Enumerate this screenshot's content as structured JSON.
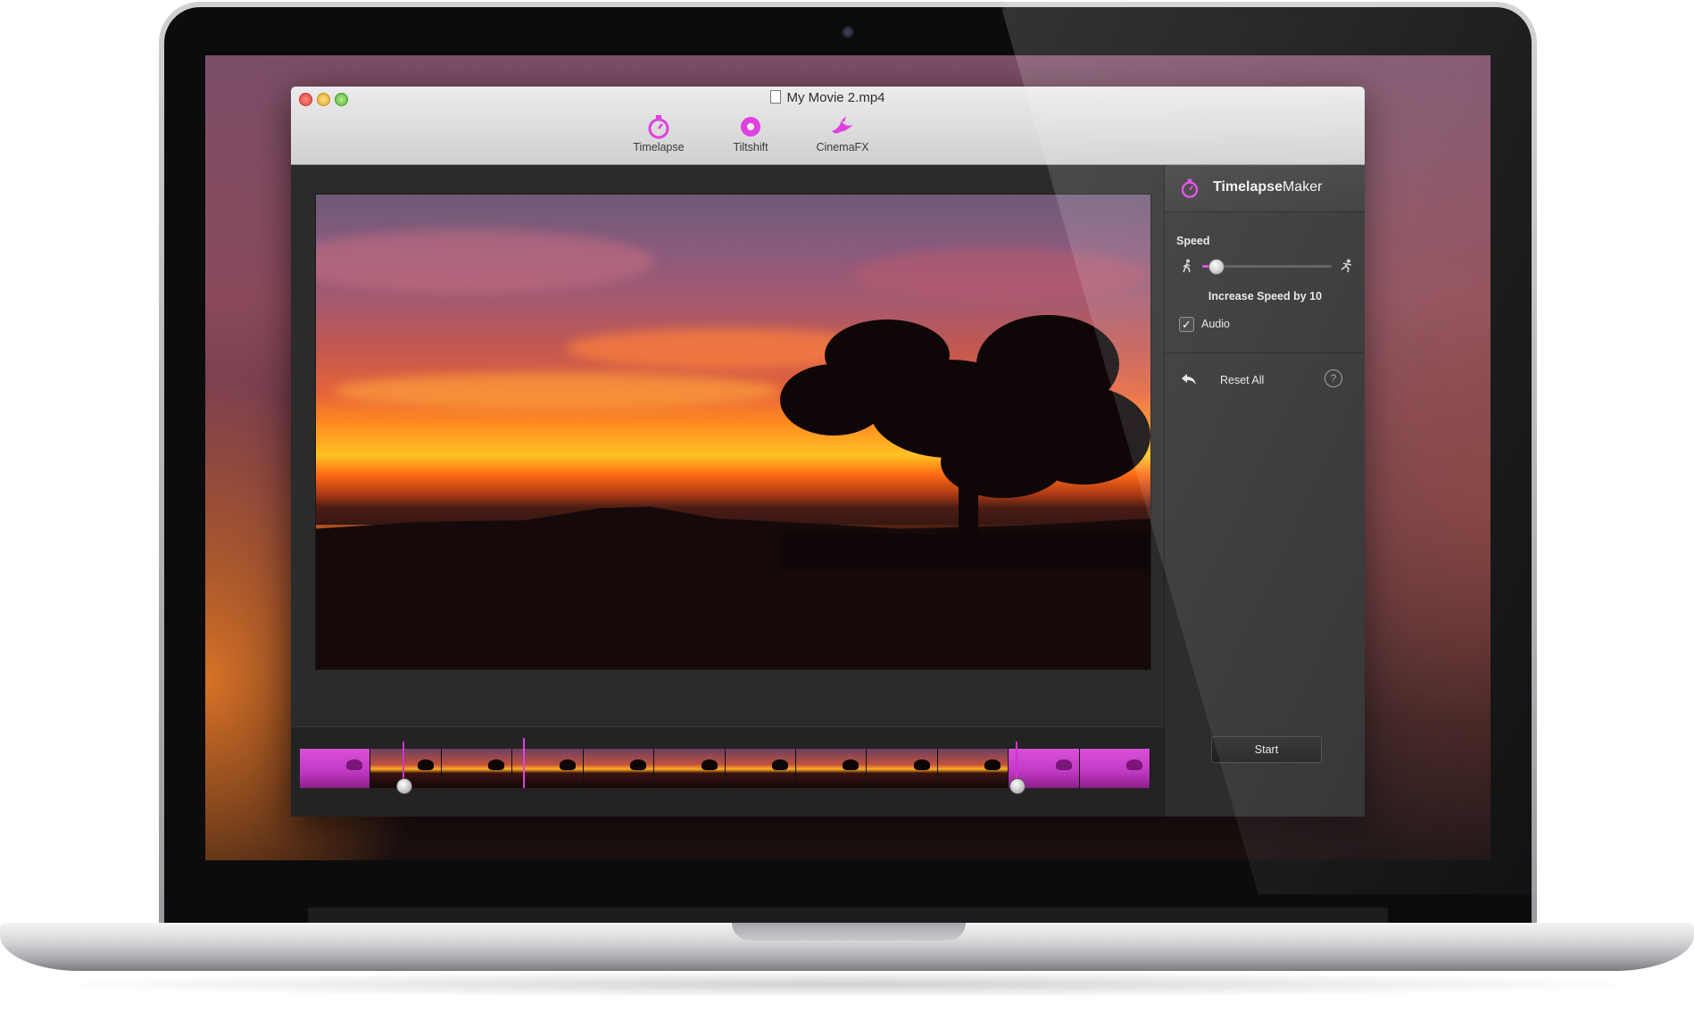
{
  "window": {
    "title": "My Movie 2.mp4"
  },
  "toolbar": {
    "tools": [
      {
        "label": "Timelapse",
        "icon": "stopwatch-icon"
      },
      {
        "label": "Tiltshift",
        "icon": "tiltshift-circle-icon"
      },
      {
        "label": "CinemaFX",
        "icon": "bird-icon"
      }
    ]
  },
  "sidebar": {
    "title_bold": "Timelapse",
    "title_regular": "Maker",
    "speed_label": "Speed",
    "speed_slider_value": 0.1,
    "speed_description": "Increase Speed by 10",
    "audio_label": "Audio",
    "audio_checked": true,
    "reset_label": "Reset All",
    "help_symbol": "?",
    "start_label": "Start"
  },
  "timeline": {
    "frame_count": 12,
    "trim_start": 0.122,
    "trim_end": 0.843,
    "playhead": 0.263
  },
  "colors": {
    "accent": "#e040e0",
    "window_bg": "#2b2b2c",
    "sidebar_bg": "#2d2d2e"
  }
}
